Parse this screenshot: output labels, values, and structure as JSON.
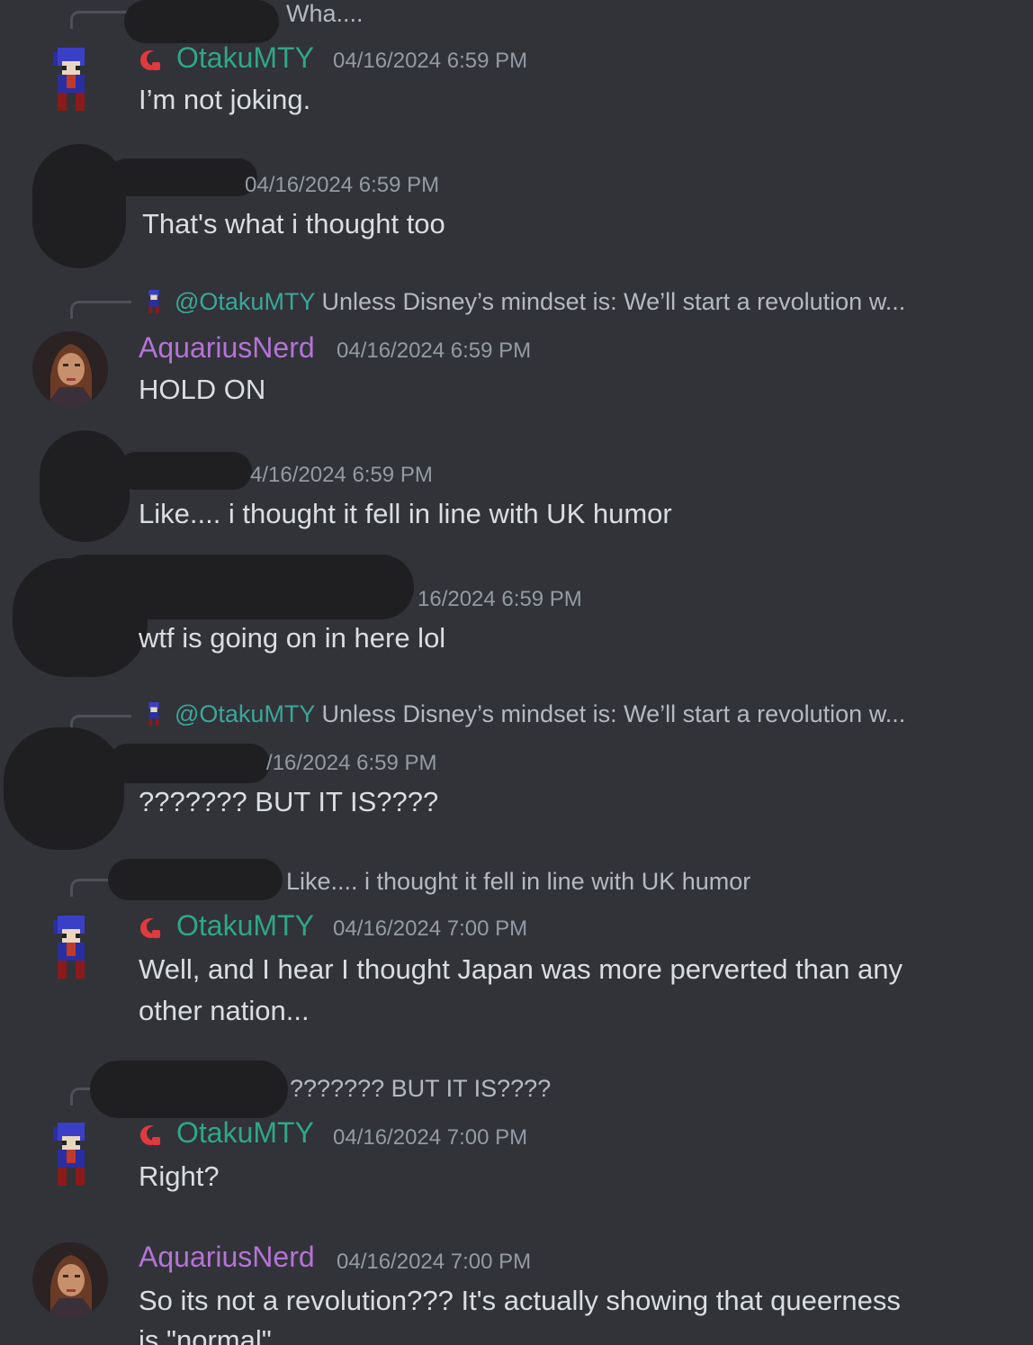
{
  "users": {
    "otaku": {
      "name": "OtakuMTY",
      "color": "#2fa787"
    },
    "aquarius": {
      "name": "AquariusNerd",
      "color": "#b573d6"
    }
  },
  "replies": {
    "r0": "Wha....",
    "r1_mention": "@OtakuMTY",
    "r1_text": "Unless Disney’s mindset is: We’ll start a revolution w...",
    "r2_mention": "@OtakuMTY",
    "r2_text": "Unless Disney’s mindset is: We’ll start a revolution w...",
    "r3": "Like.... i thought it fell in line with UK humor",
    "r4": "??????? BUT IT IS????"
  },
  "messages": [
    {
      "ts": "04/16/2024 6:59 PM",
      "text": "I’m not joking."
    },
    {
      "ts": "04/16/2024 6:59 PM",
      "text": "That's what i thought too"
    },
    {
      "ts": "04/16/2024 6:59 PM",
      "text": "HOLD ON"
    },
    {
      "ts": "04/16/2024 6:59 PM",
      "text": "Like.... i thought it fell in line with UK humor"
    },
    {
      "ts": "16/2024 6:59 PM",
      "text": "wtf is going on in here lol"
    },
    {
      "ts": "/16/2024 6:59 PM",
      "text": "??????? BUT IT IS????"
    },
    {
      "ts": "04/16/2024 7:00 PM",
      "text1": "Well, and I hear I thought Japan was more perverted than any",
      "text2": "other nation..."
    },
    {
      "ts": "04/16/2024 7:00 PM",
      "text": "Right?"
    },
    {
      "ts": "04/16/2024 7:00 PM",
      "text1": "So its not a revolution??? It's actually showing that queerness",
      "text2": "is \"normal\""
    }
  ],
  "partial_timestamps": {
    "m1": "04/16/2024 6:59 PM",
    "m3": "4/16/2024 6:59 PM"
  },
  "icons": {
    "badge": "red-crescent-badge-icon",
    "pixel_avatar": "pixel-character-avatar-icon"
  }
}
